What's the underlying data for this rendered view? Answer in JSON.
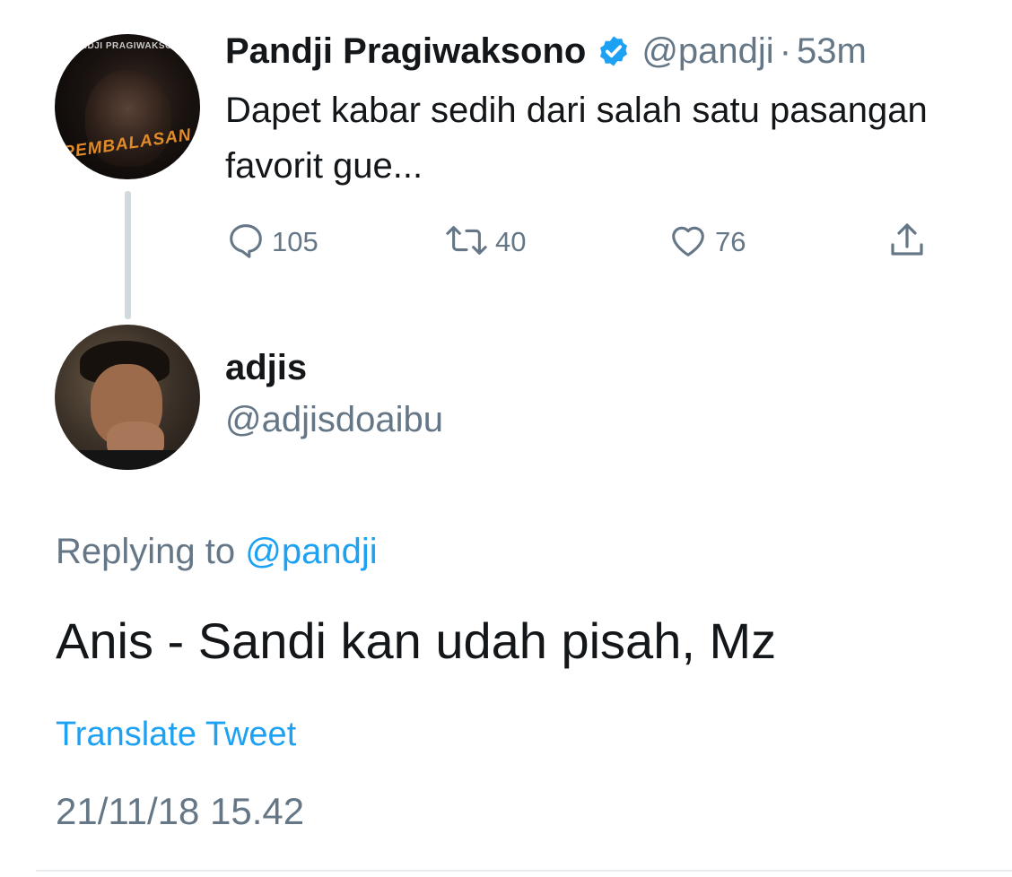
{
  "original_tweet": {
    "author_name": "Pandji Pragiwaksono",
    "verified": true,
    "handle": "@pandji",
    "separator": "·",
    "time_ago": "53m",
    "text": "Dapet kabar sedih dari salah satu pasangan favorit gue...",
    "avatar_brand_text": "PANDJI PRAGIWAKSONO",
    "avatar_album_text": "PEMBALASAN",
    "actions": {
      "reply_count": "105",
      "retweet_count": "40",
      "like_count": "76"
    }
  },
  "reply_tweet": {
    "author_name": "adjis",
    "handle": "@adjisdoaibu",
    "replying_to_prefix": "Replying to",
    "replying_to_handle": "@pandji",
    "text": "Anis - Sandi kan udah pisah, Mz",
    "translate_label": "Translate Tweet",
    "timestamp": "21/11/18 15.42"
  },
  "colors": {
    "accent": "#1da1f2",
    "text_primary": "#14171a",
    "text_secondary": "#657786",
    "thread_line": "#cfd9de"
  },
  "icons": {
    "verified": "verified-badge-icon",
    "reply": "speech-bubble-icon",
    "retweet": "retweet-arrows-icon",
    "like": "heart-icon",
    "share": "share-upload-icon"
  }
}
